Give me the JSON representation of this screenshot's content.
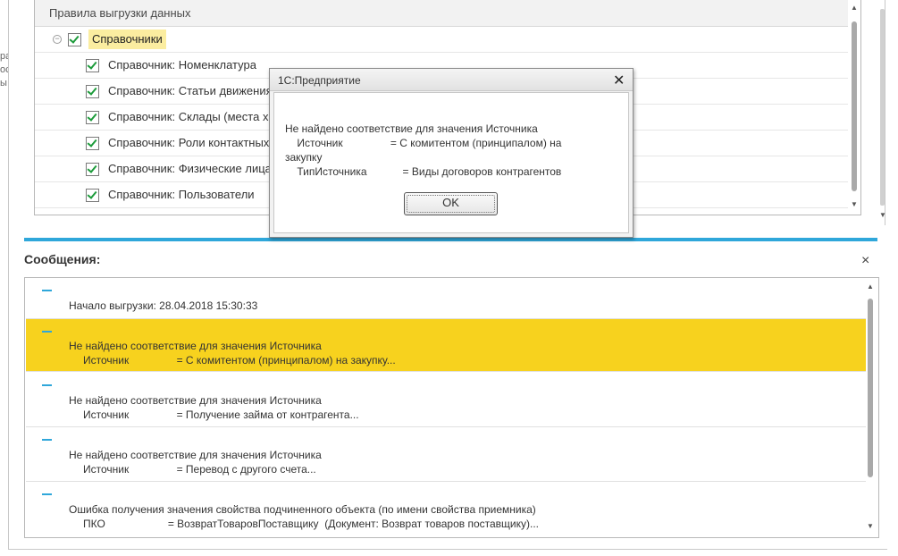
{
  "left_fragment": [
    "ра",
    "ос",
    "ы"
  ],
  "tree": {
    "header": "Правила выгрузки данных",
    "group": "Справочники",
    "items": [
      "Справочник: Номенклатура",
      "Справочник: Статьи движения",
      "Справочник: Склады (места хр",
      "Справочник: Роли контактных",
      "Справочник: Физические лица",
      "Справочник: Пользователи"
    ]
  },
  "messages": {
    "title": "Сообщения:",
    "close_glyph": "×",
    "items": [
      {
        "line1": "Начало выгрузки: 28.04.2018 15:30:33",
        "line2": ""
      },
      {
        "line1": "Не найдено соответствие для значения Источника",
        "line2": "Источник                = С комитентом (принципалом) на закупку..."
      },
      {
        "line1": "Не найдено соответствие для значения Источника",
        "line2": "Источник                = Получение займа от контрагента..."
      },
      {
        "line1": "Не найдено соответствие для значения Источника",
        "line2": "Источник                = Перевод с другого счета..."
      },
      {
        "line1": "Ошибка получения значения свойства подчиненного объекта (по имени свойства приемника)",
        "line2": "ПКО                     = ВозвратТоваровПоставщику  (Документ: Возврат товаров поставщику)..."
      }
    ]
  },
  "dialog": {
    "title": "1С:Предприятие",
    "close_glyph": "✕",
    "line1": "Не найдено соответствие для значения Источника",
    "line2": "    Источник                = С комитентом (принципалом) на",
    "line3": "закупку",
    "line4": "    ТипИсточника            = Виды договоров контрагентов",
    "ok_label": "OK"
  },
  "colors": {
    "accent": "#2fa7da",
    "highlight": "#f7d21e",
    "group_highlight": "#fbeda0",
    "check": "#1c9b3a"
  }
}
